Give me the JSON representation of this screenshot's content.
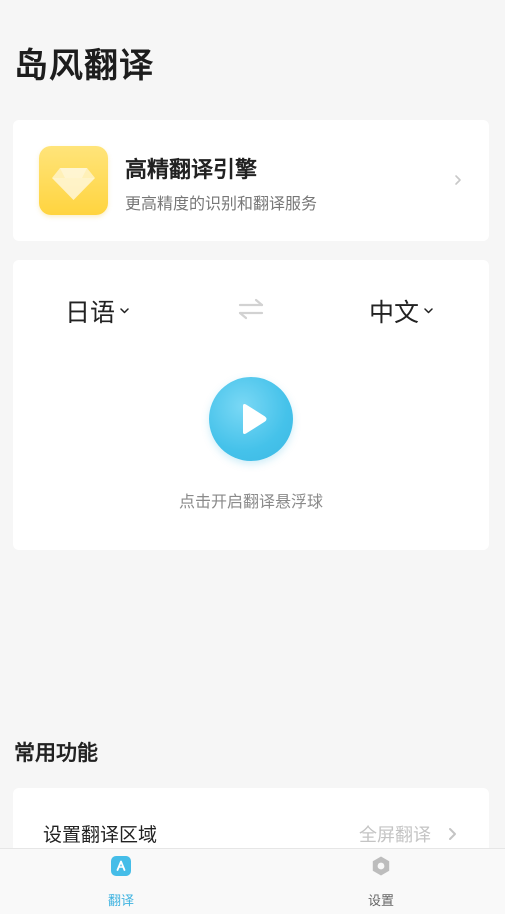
{
  "app": {
    "title": "岛风翻译"
  },
  "premium": {
    "title": "高精翻译引擎",
    "subtitle": "更高精度的识别和翻译服务",
    "icon": "diamond-icon"
  },
  "translator": {
    "source_lang": "日语",
    "target_lang": "中文",
    "swap_icon": "swap-icon",
    "play_icon": "play-icon",
    "hint": "点击开启翻译悬浮球"
  },
  "features": {
    "section_title": "常用功能",
    "items": [
      {
        "label": "设置翻译区域",
        "value": "全屏翻译"
      }
    ]
  },
  "nav": {
    "items": [
      {
        "label": "翻译",
        "icon": "translate-icon",
        "active": true
      },
      {
        "label": "设置",
        "icon": "gear-icon",
        "active": false
      }
    ]
  },
  "colors": {
    "accent": "#3fb3e0",
    "premium": "#ffd43f",
    "background": "#f6f6f6"
  }
}
